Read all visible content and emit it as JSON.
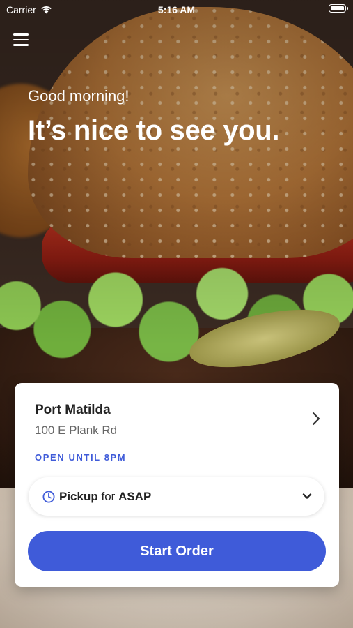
{
  "status_bar": {
    "carrier": "Carrier",
    "time": "5:16 AM"
  },
  "header": {
    "greeting": "Good morning!",
    "headline": "It’s nice to see you."
  },
  "card": {
    "store_name": "Port Matilda",
    "store_address": "100 E Plank Rd",
    "hours": "OPEN UNTIL 8PM",
    "pickup": {
      "mode": "Pickup",
      "connector": "for",
      "time": "ASAP"
    },
    "start_label": "Start Order"
  },
  "colors": {
    "accent": "#3f5bd9",
    "card_bg": "#ffffff"
  },
  "icons": [
    "wifi-icon",
    "battery-icon",
    "menu-icon",
    "chevron-right-icon",
    "clock-icon",
    "chevron-down-icon"
  ]
}
